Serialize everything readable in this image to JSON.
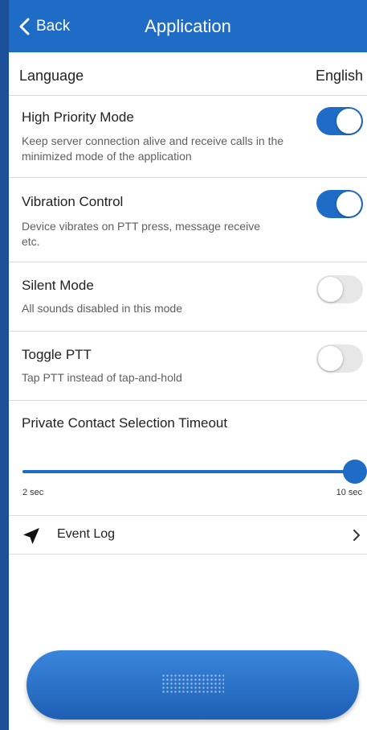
{
  "header": {
    "back_label": "Back",
    "title": "Application",
    "color": "#1f6cc6"
  },
  "language": {
    "label": "Language",
    "value": "English"
  },
  "settings": [
    {
      "title": "High Priority Mode",
      "description": "Keep server connection alive and receive calls in the minimized mode of the application",
      "enabled": true
    },
    {
      "title": "Vibration Control",
      "description": "Device vibrates on PTT press, message receive etc.",
      "enabled": true
    },
    {
      "title": "Silent Mode",
      "description": "All sounds disabled in this mode",
      "enabled": false
    },
    {
      "title": "Toggle PTT",
      "description": "Tap PTT instead of tap-and-hold",
      "enabled": false
    }
  ],
  "timeout": {
    "title": "Private Contact Selection Timeout",
    "min_label": "2 sec",
    "max_label": "10 sec",
    "min": 2,
    "max": 10,
    "value": 10
  },
  "event_log": {
    "label": "Event Log",
    "icon": "navigation-arrow-icon"
  },
  "ptt_button": {
    "icon": "grip-dots-icon"
  }
}
